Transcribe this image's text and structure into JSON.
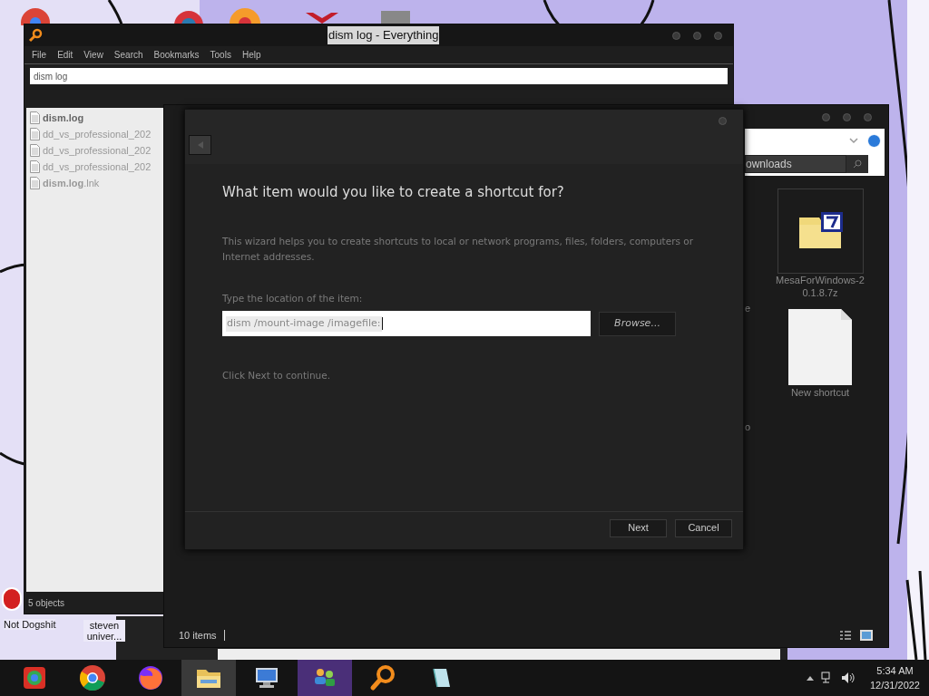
{
  "desktop": {
    "icons": [
      {
        "label": "Not Dogshit",
        "kind": "red"
      },
      {
        "label": "steven univer...",
        "kind": "none"
      }
    ]
  },
  "everything_window": {
    "title": "dism log - Everything",
    "menu": [
      "File",
      "Edit",
      "View",
      "Search",
      "Bookmarks",
      "Tools",
      "Help"
    ],
    "search": {
      "value": "dism log"
    },
    "results": [
      {
        "name": "dism.log",
        "bold": true
      },
      {
        "name": "dd_vs_professional_202",
        "bold": false
      },
      {
        "name": "dd_vs_professional_202",
        "bold": false
      },
      {
        "name": "dd_vs_professional_202",
        "bold": false
      },
      {
        "name": "**dism.log**.lnk",
        "bold": false
      }
    ],
    "status": "5 objects"
  },
  "explorer_window": {
    "search": {
      "value": "ownloads"
    },
    "cut_labels": [
      "e",
      "o"
    ],
    "files": [
      {
        "name": "MesaForWindows-20.1.8.7z",
        "kind": "archive",
        "selected": true
      },
      {
        "name": "New shortcut",
        "kind": "blank",
        "selected": false
      }
    ],
    "status": "10 items"
  },
  "wizard": {
    "heading": "What item would you like to create a shortcut for?",
    "description": "This wizard helps you to create shortcuts to local or network programs, files, folders, computers or Internet addresses.",
    "field_label": "Type the location of the item:",
    "field_value": "dism /mount-image /imagefile:",
    "browse": "Browse...",
    "hint": "Click Next to continue.",
    "buttons": [
      {
        "label": "Next"
      },
      {
        "label": "Cancel"
      }
    ]
  },
  "taskbar": {
    "apps": [
      {
        "kind": "browser-alt",
        "active": false
      },
      {
        "kind": "browser",
        "active": false
      },
      {
        "kind": "firefox",
        "active": false
      },
      {
        "kind": "folder",
        "active": true
      },
      {
        "kind": "monitor",
        "active": false
      },
      {
        "kind": "people",
        "active": true
      },
      {
        "kind": "search",
        "active": false
      },
      {
        "kind": "notepad",
        "active": false
      }
    ],
    "time": "5:34 AM",
    "date": "12/31/2022"
  }
}
